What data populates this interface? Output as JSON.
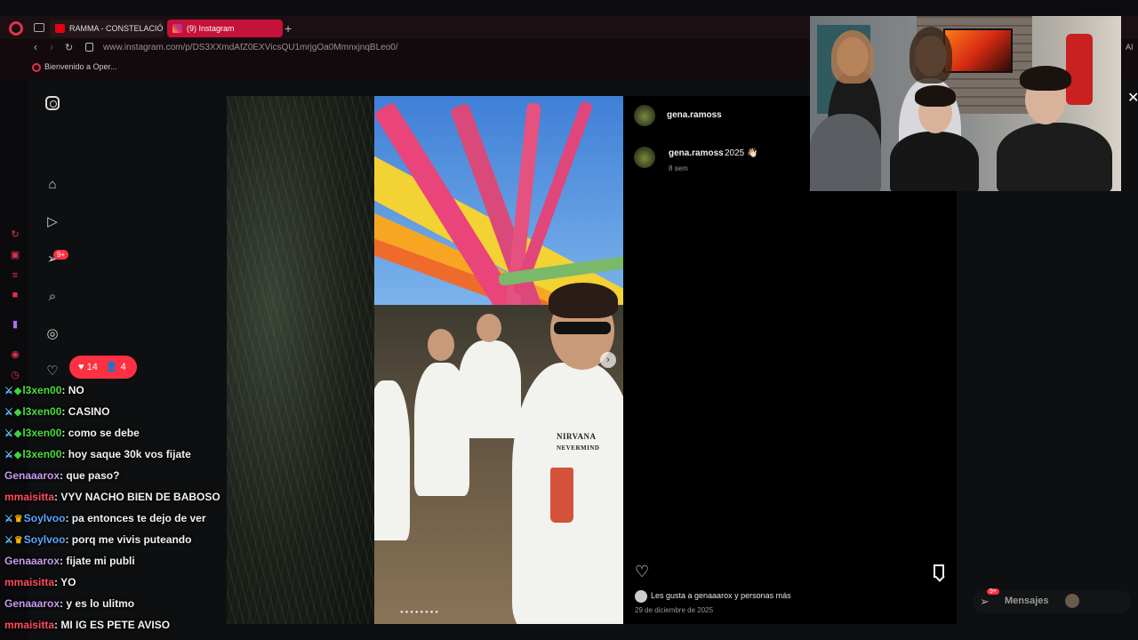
{
  "browser": {
    "tabs": [
      {
        "label": "RAMMA - CONSTELACIÓN"
      },
      {
        "label": "(9) Instagram"
      }
    ],
    "url": "www.instagram.com/p/DS3XXmdAfZ0EXVicsQU1mrjgOa0MmnxjnqBLeo0/",
    "bookmark": "Bienvenido a Oper...",
    "ai_label": "AI"
  },
  "instagram": {
    "notifications_badge": "9+",
    "like_pill": {
      "likes": "14",
      "followers": "4"
    },
    "post": {
      "username": "gena.ramoss",
      "caption_user": "gena.ramoss",
      "caption_text": "2025 👋🏻",
      "caption_time": "8 sem",
      "shirt_text_1": "NIRVANA",
      "shirt_text_2": "NEVERMIND",
      "likes_text": "Les gusta a genaaarox y personas más",
      "date": "29 de diciembre de 2025"
    },
    "messages": {
      "label": "Mensajes",
      "badge": "9+"
    }
  },
  "chat": [
    {
      "badges": [
        "sword",
        "gem"
      ],
      "user": "l3xen00",
      "color": "green",
      "text": "NO"
    },
    {
      "badges": [
        "sword",
        "gem"
      ],
      "user": "l3xen00",
      "color": "green",
      "text": "CASINO"
    },
    {
      "badges": [
        "sword",
        "gem"
      ],
      "user": "l3xen00",
      "color": "green",
      "text": "como se debe"
    },
    {
      "badges": [
        "sword",
        "gem"
      ],
      "user": "l3xen00",
      "color": "green",
      "text": "hoy saque 30k vos fijate"
    },
    {
      "badges": [],
      "user": "Genaaarox",
      "color": "purple",
      "text": "que paso?"
    },
    {
      "badges": [],
      "user": "mmaisitta",
      "color": "red",
      "text": "VYV NACHO BIEN DE BABOSO"
    },
    {
      "badges": [
        "sword",
        "crown"
      ],
      "user": "Soylvoo",
      "color": "blue",
      "text": "pa entonces te dejo de ver"
    },
    {
      "badges": [
        "sword",
        "crown"
      ],
      "user": "Soylvoo",
      "color": "blue",
      "text": "porq me vivis puteando"
    },
    {
      "badges": [],
      "user": "Genaaarox",
      "color": "purple",
      "text": "fijate mi publi"
    },
    {
      "badges": [],
      "user": "mmaisitta",
      "color": "red",
      "text": "YO"
    },
    {
      "badges": [],
      "user": "Genaaarox",
      "color": "purple",
      "text": "y es lo ulitmo"
    },
    {
      "badges": [],
      "user": "mmaisitta",
      "color": "red",
      "text": "MI IG ES PETE AVISO"
    }
  ],
  "colors": {
    "opera_red": "#e0324b",
    "active_tab": "#c4123a",
    "ig_like": "#ff3040",
    "chat_green": "#47e03a",
    "chat_purple": "#c89cf0",
    "chat_red": "#ff4d5a",
    "chat_blue": "#5aa8ff"
  },
  "icons": [
    "instagram-logo-icon",
    "home-icon",
    "reels-icon",
    "notifications-icon",
    "search-icon",
    "explore-icon",
    "heart-icon",
    "bookmark-icon",
    "messages-icon",
    "close-icon"
  ]
}
